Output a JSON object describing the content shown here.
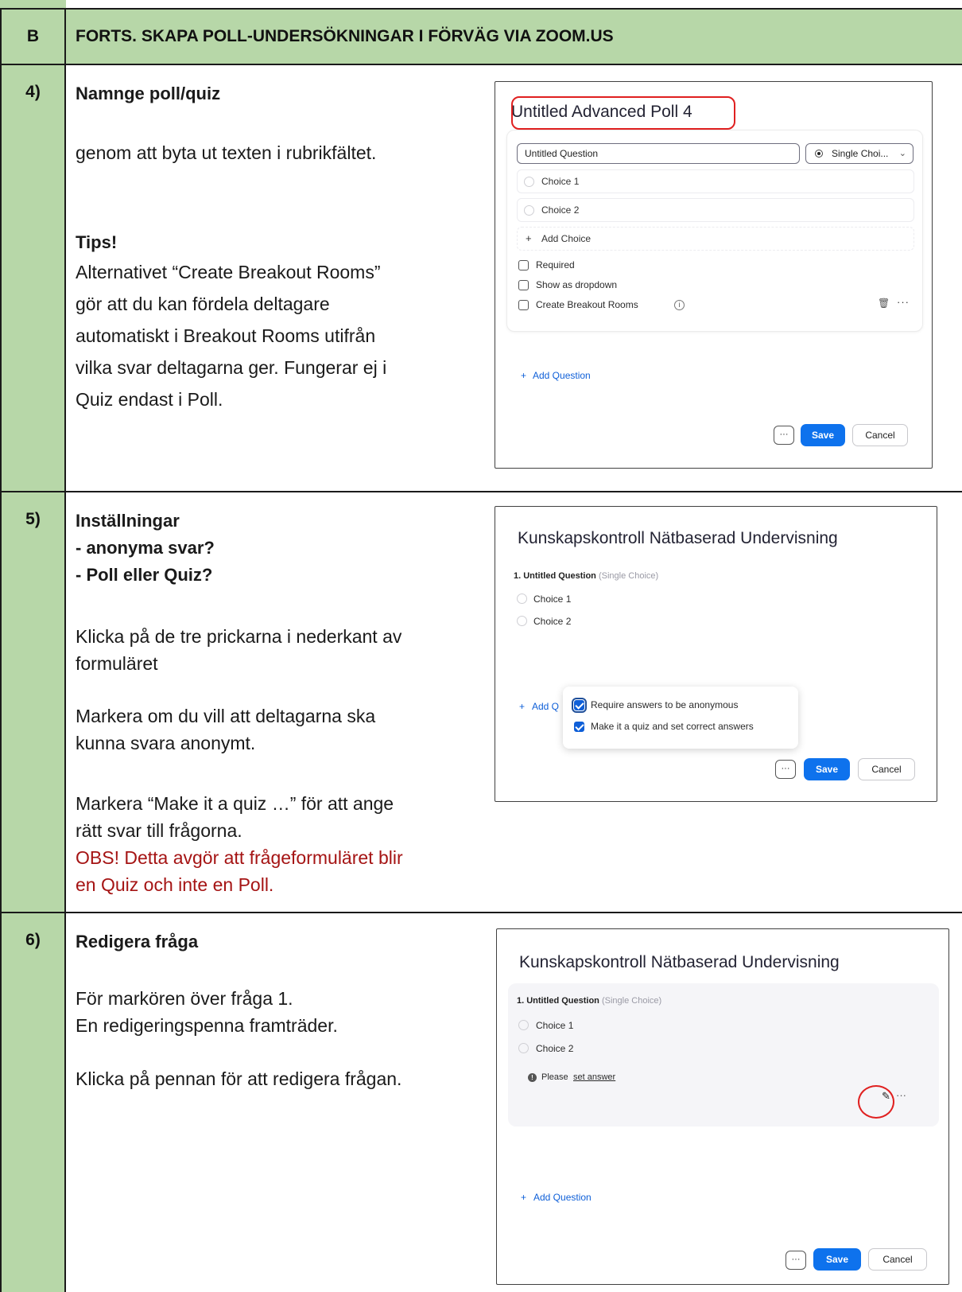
{
  "header": {
    "col_label": "B",
    "title": "FORTS. SKAPA POLL-UNDERSÖKNINGAR I FÖRVÄG VIA ZOOM.US"
  },
  "step4": {
    "number": "4)",
    "heading": "Namnge poll/quiz",
    "body": "genom att byta ut texten i rubrikfältet.",
    "tips_heading": "Tips!",
    "tips_lines": [
      "Alternativet “Create Breakout Rooms”",
      "gör att du kan fördela deltagare",
      "automatiskt i Breakout Rooms utifrån",
      "vilka svar deltagarna ger. Fungerar ej i",
      "Quiz endast i Poll."
    ],
    "shot": {
      "poll_title": "Untitled Advanced Poll 4",
      "question_placeholder": "Untitled Question",
      "type_select": "Single Choi...",
      "choices": [
        "Choice 1",
        "Choice 2"
      ],
      "add_choice": "Add Choice",
      "checkboxes": [
        "Required",
        "Show as dropdown",
        "Create Breakout Rooms"
      ],
      "add_question": "Add Question",
      "dots": "···",
      "save": "Save",
      "cancel": "Cancel"
    }
  },
  "step5": {
    "number": "5)",
    "heading_lines": [
      "Inställningar",
      "- anonyma svar?",
      "- Poll eller Quiz?"
    ],
    "p1_lines": [
      "Klicka på de tre prickarna i nederkant av",
      "formuläret"
    ],
    "p2_lines": [
      "Markera om du vill att deltagarna ska",
      "kunna svara anonymt."
    ],
    "p3_lines": [
      "Markera “Make it a quiz …” för att ange",
      "rätt svar till frågorna."
    ],
    "warning_lines": [
      "OBS! Detta avgör att frågeformuläret blir",
      "en Quiz och inte en Poll."
    ],
    "shot": {
      "poll_title": "Kunskapskontroll Nätbaserad Undervisning",
      "question_label": "1. Untitled Question",
      "question_type": "(Single Choice)",
      "choices": [
        "Choice 1",
        "Choice 2"
      ],
      "add_question_partial": "Add Q",
      "options": [
        "Require answers to be anonymous",
        "Make it a quiz and set correct answers"
      ],
      "dots": "···",
      "save": "Save",
      "cancel": "Cancel"
    }
  },
  "step6": {
    "number": "6)",
    "heading": "Redigera fråga",
    "p1_lines": [
      "För markören över fråga 1.",
      "En redigeringspenna framträder."
    ],
    "p2": "Klicka på pennan för att redigera frågan.",
    "shot": {
      "poll_title": "Kunskapskontroll Nätbaserad Undervisning",
      "question_label": "1. Untitled Question",
      "question_type": "(Single Choice)",
      "choices": [
        "Choice 1",
        "Choice 2"
      ],
      "please": "Please",
      "set_answer": "set answer",
      "add_question": "Add Question",
      "dots": "···",
      "save": "Save",
      "cancel": "Cancel"
    }
  }
}
